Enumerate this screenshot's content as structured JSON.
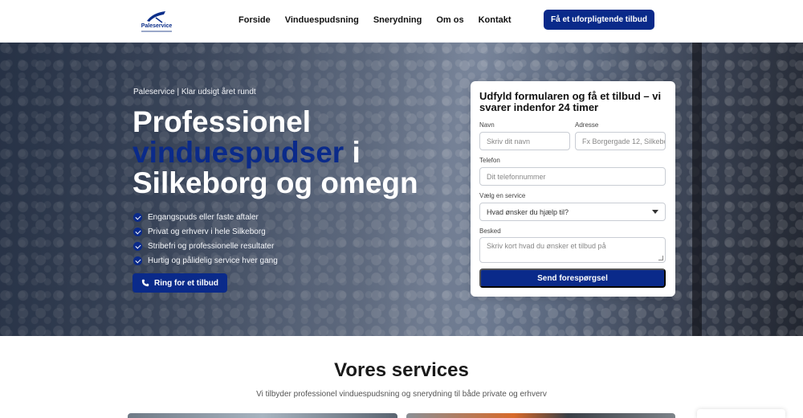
{
  "header": {
    "logo_text": "Paleservice",
    "nav": [
      "Forside",
      "Vinduespudsning",
      "Snerydning",
      "Om os",
      "Kontakt"
    ],
    "cta": "Få et uforpligtende tilbud"
  },
  "hero": {
    "eyebrow": "Paleservice | Klar udsigt året rundt",
    "headline_1": "Professionel",
    "headline_accent": "vinduespudser",
    "headline_2": "i",
    "headline_3": "Silkeborg og omegn",
    "checks": [
      "Engangspuds eller faste aftaler",
      "Privat og erhverv i hele Silkeborg",
      "Stribefri og professionelle resultater",
      "Hurtig og pålidelig service hver gang"
    ],
    "call_button": "Ring for et tilbud"
  },
  "form": {
    "title": "Udfyld formularen og få et tilbud – vi svarer indenfor 24 timer",
    "name_label": "Navn",
    "name_placeholder": "Skriv dit navn",
    "address_label": "Adresse",
    "address_placeholder": "Fx Borgergade 12, Silkeborg",
    "phone_label": "Telefon",
    "phone_placeholder": "Dit telefonnummer",
    "service_label": "Vælg en service",
    "service_selected": "Hvad ønsker du hjælp til?",
    "message_label": "Besked",
    "message_placeholder": "Skriv kort hvad du ønsker et tilbud på",
    "submit": "Send forespørgsel"
  },
  "services": {
    "title": "Vores services",
    "subtitle": "Vi tilbyder professionel vinduespudsning og snerydning til både private og erhverv"
  },
  "colors": {
    "brand": "#0a2a8a",
    "text": "#1a1a1a"
  }
}
